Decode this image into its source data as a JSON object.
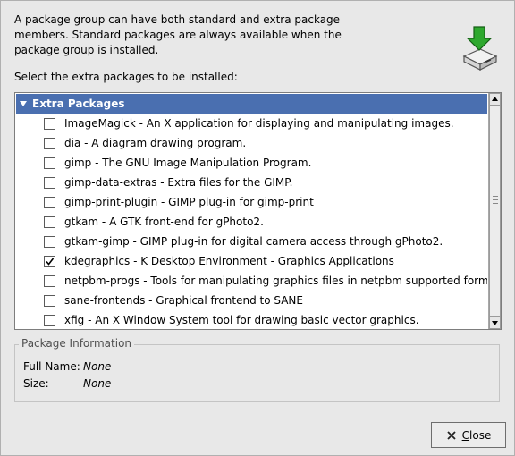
{
  "description": "A package group can have both standard and extra package\nmembers.  Standard packages are always available when the\npackage group is installed.",
  "select_label": "Select the extra packages to be installed:",
  "icons": {
    "package_install": "package-download-icon",
    "expander": "triangle-down-icon",
    "close": "close-x-icon"
  },
  "group": {
    "name": "Extra Packages",
    "expanded": true
  },
  "packages": [
    {
      "label": "ImageMagick - An X application for displaying and manipulating images.",
      "checked": false
    },
    {
      "label": "dia - A diagram drawing program.",
      "checked": false
    },
    {
      "label": "gimp - The GNU Image Manipulation Program.",
      "checked": false
    },
    {
      "label": "gimp-data-extras - Extra files for the GIMP.",
      "checked": false
    },
    {
      "label": "gimp-print-plugin - GIMP plug-in for gimp-print",
      "checked": false
    },
    {
      "label": "gtkam - A GTK front-end for gPhoto2.",
      "checked": false
    },
    {
      "label": "gtkam-gimp - GIMP plug-in for digital camera access through gPhoto2.",
      "checked": false
    },
    {
      "label": "kdegraphics - K Desktop Environment - Graphics Applications",
      "checked": true
    },
    {
      "label": "netpbm-progs - Tools for manipulating graphics files in netpbm supported formats.",
      "checked": false
    },
    {
      "label": "sane-frontends - Graphical frontend to SANE",
      "checked": false
    },
    {
      "label": "xfig - An X Window System tool for drawing basic vector graphics.",
      "checked": false
    }
  ],
  "info": {
    "title": "Package Information",
    "full_name_label": "Full Name:",
    "full_name_value": "None",
    "size_label": "Size:",
    "size_value": "None"
  },
  "close_button": {
    "label": "Close"
  },
  "colors": {
    "selection": "#4a6fb0",
    "background": "#e8e8e8",
    "icon_green": "#2ea82e"
  }
}
